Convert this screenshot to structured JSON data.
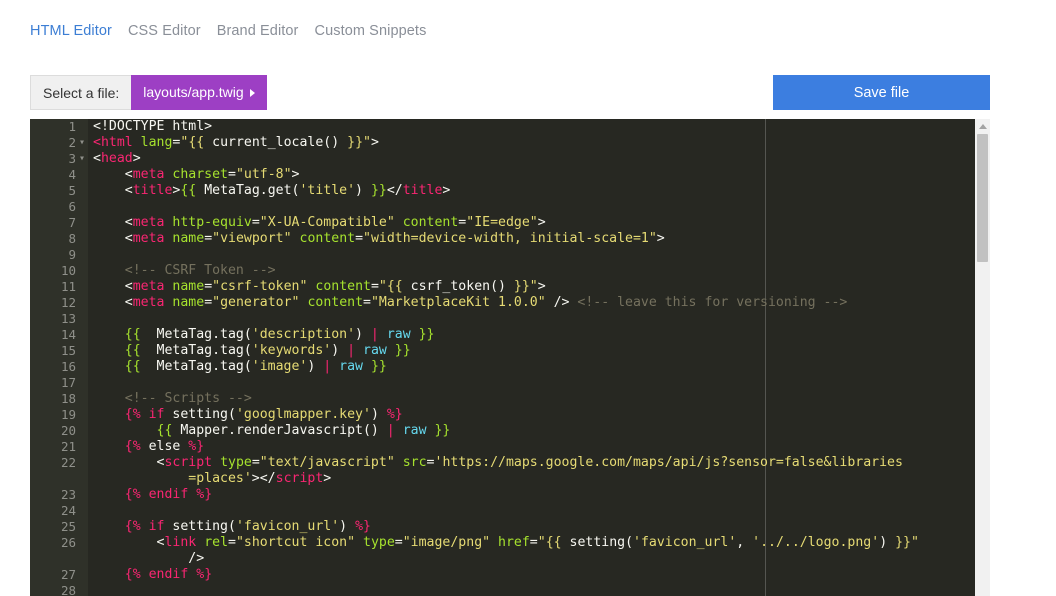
{
  "tabs": [
    {
      "label": "HTML Editor",
      "active": true
    },
    {
      "label": "CSS Editor",
      "active": false
    },
    {
      "label": "Brand Editor",
      "active": false
    },
    {
      "label": "Custom Snippets",
      "active": false
    }
  ],
  "file_selector": {
    "label": "Select a file:",
    "value": "layouts/app.twig"
  },
  "save_button": {
    "label": "Save file"
  },
  "editor": {
    "lines": [
      {
        "n": "1",
        "fold": false,
        "tokens": [
          [
            "",
            "<!DOCTYPE html>"
          ]
        ]
      },
      {
        "n": "2",
        "fold": true,
        "tokens": [
          [
            "tag",
            "<html"
          ],
          [
            "",
            " "
          ],
          [
            "attr",
            "lang"
          ],
          [
            "",
            "="
          ],
          [
            "str",
            "\"{{ "
          ],
          [
            "",
            "current_locale() "
          ],
          [
            "str",
            "}}\""
          ],
          [
            "",
            ">"
          ]
        ]
      },
      {
        "n": "3",
        "fold": true,
        "tokens": [
          [
            "",
            "<"
          ],
          [
            "tag",
            "head"
          ],
          [
            "",
            ">"
          ]
        ]
      },
      {
        "n": "4",
        "fold": false,
        "tokens": [
          [
            "",
            "    <"
          ],
          [
            "tag",
            "meta"
          ],
          [
            "",
            " "
          ],
          [
            "attr",
            "charset"
          ],
          [
            "",
            "="
          ],
          [
            "str",
            "\"utf-8\""
          ],
          [
            "",
            ">"
          ]
        ]
      },
      {
        "n": "5",
        "fold": false,
        "tokens": [
          [
            "",
            "    <"
          ],
          [
            "tag",
            "title"
          ],
          [
            "",
            ">"
          ],
          [
            "twig",
            "{{"
          ],
          [
            "",
            " MetaTag.get("
          ],
          [
            "str",
            "'title'"
          ],
          [
            "",
            ") "
          ],
          [
            "twig",
            "}}"
          ],
          [
            "",
            "</"
          ],
          [
            "tag",
            "title"
          ],
          [
            "",
            ">"
          ]
        ]
      },
      {
        "n": "6",
        "fold": false,
        "tokens": [
          [
            "",
            ""
          ]
        ]
      },
      {
        "n": "7",
        "fold": false,
        "tokens": [
          [
            "",
            "    <"
          ],
          [
            "tag",
            "meta"
          ],
          [
            "",
            " "
          ],
          [
            "attr",
            "http-equiv"
          ],
          [
            "",
            "="
          ],
          [
            "str",
            "\"X-UA-Compatible\""
          ],
          [
            "",
            " "
          ],
          [
            "attr",
            "content"
          ],
          [
            "",
            "="
          ],
          [
            "str",
            "\"IE=edge\""
          ],
          [
            "",
            ">"
          ]
        ]
      },
      {
        "n": "8",
        "fold": false,
        "tokens": [
          [
            "",
            "    <"
          ],
          [
            "tag",
            "meta"
          ],
          [
            "",
            " "
          ],
          [
            "attr",
            "name"
          ],
          [
            "",
            "="
          ],
          [
            "str",
            "\"viewport\""
          ],
          [
            "",
            " "
          ],
          [
            "attr",
            "content"
          ],
          [
            "",
            "="
          ],
          [
            "str",
            "\"width=device-width, initial-scale=1\""
          ],
          [
            "",
            ">"
          ]
        ]
      },
      {
        "n": "9",
        "fold": false,
        "tokens": [
          [
            "",
            ""
          ]
        ]
      },
      {
        "n": "10",
        "fold": false,
        "tokens": [
          [
            "cmt",
            "    <!-- CSRF Token -->"
          ]
        ]
      },
      {
        "n": "11",
        "fold": false,
        "tokens": [
          [
            "",
            "    <"
          ],
          [
            "tag",
            "meta"
          ],
          [
            "",
            " "
          ],
          [
            "attr",
            "name"
          ],
          [
            "",
            "="
          ],
          [
            "str",
            "\"csrf-token\""
          ],
          [
            "",
            " "
          ],
          [
            "attr",
            "content"
          ],
          [
            "",
            "="
          ],
          [
            "str",
            "\"{{ "
          ],
          [
            "",
            "csrf_token() "
          ],
          [
            "str",
            "}}\""
          ],
          [
            "",
            ">"
          ]
        ]
      },
      {
        "n": "12",
        "fold": false,
        "tokens": [
          [
            "",
            "    <"
          ],
          [
            "tag",
            "meta"
          ],
          [
            "",
            " "
          ],
          [
            "attr",
            "name"
          ],
          [
            "",
            "="
          ],
          [
            "str",
            "\"generator\""
          ],
          [
            "",
            " "
          ],
          [
            "attr",
            "content"
          ],
          [
            "",
            "="
          ],
          [
            "str",
            "\"MarketplaceKit 1.0.0\""
          ],
          [
            "",
            " /> "
          ],
          [
            "cmt",
            "<!-- leave this for versioning -->"
          ]
        ]
      },
      {
        "n": "13",
        "fold": false,
        "tokens": [
          [
            "",
            ""
          ]
        ]
      },
      {
        "n": "14",
        "fold": false,
        "tokens": [
          [
            "twig",
            "    {{"
          ],
          [
            "",
            "  MetaTag.tag("
          ],
          [
            "str",
            "'description'"
          ],
          [
            "",
            ") "
          ],
          [
            "pipe",
            "|"
          ],
          [
            "",
            " "
          ],
          [
            "filter",
            "raw"
          ],
          [
            "",
            " "
          ],
          [
            "twig",
            "}}"
          ]
        ]
      },
      {
        "n": "15",
        "fold": false,
        "tokens": [
          [
            "twig",
            "    {{"
          ],
          [
            "",
            "  MetaTag.tag("
          ],
          [
            "str",
            "'keywords'"
          ],
          [
            "",
            ") "
          ],
          [
            "pipe",
            "|"
          ],
          [
            "",
            " "
          ],
          [
            "filter",
            "raw"
          ],
          [
            "",
            " "
          ],
          [
            "twig",
            "}}"
          ]
        ]
      },
      {
        "n": "16",
        "fold": false,
        "tokens": [
          [
            "twig",
            "    {{"
          ],
          [
            "",
            "  MetaTag.tag("
          ],
          [
            "str",
            "'image'"
          ],
          [
            "",
            ") "
          ],
          [
            "pipe",
            "|"
          ],
          [
            "",
            " "
          ],
          [
            "filter",
            "raw"
          ],
          [
            "",
            " "
          ],
          [
            "twig",
            "}}"
          ]
        ]
      },
      {
        "n": "17",
        "fold": false,
        "tokens": [
          [
            "",
            ""
          ]
        ]
      },
      {
        "n": "18",
        "fold": false,
        "tokens": [
          [
            "cmt",
            "    <!-- Scripts -->"
          ]
        ]
      },
      {
        "n": "19",
        "fold": false,
        "tokens": [
          [
            "ctrl",
            "    {%"
          ],
          [
            "",
            " "
          ],
          [
            "ctrl",
            "if"
          ],
          [
            "",
            " setting("
          ],
          [
            "str",
            "'googlmapper.key'"
          ],
          [
            "",
            ") "
          ],
          [
            "ctrl",
            "%}"
          ]
        ]
      },
      {
        "n": "20",
        "fold": false,
        "tokens": [
          [
            "",
            "        "
          ],
          [
            "twig",
            "{{"
          ],
          [
            "",
            " Mapper.renderJavascript() "
          ],
          [
            "pipe",
            "|"
          ],
          [
            "",
            " "
          ],
          [
            "filter",
            "raw"
          ],
          [
            "",
            " "
          ],
          [
            "twig",
            "}}"
          ]
        ]
      },
      {
        "n": "21",
        "fold": false,
        "tokens": [
          [
            "ctrl",
            "    {%"
          ],
          [
            "",
            " else "
          ],
          [
            "ctrl",
            "%}"
          ]
        ]
      },
      {
        "n": "22",
        "fold": false,
        "tokens": [
          [
            "",
            "        <"
          ],
          [
            "tag",
            "script"
          ],
          [
            "",
            " "
          ],
          [
            "attr",
            "type"
          ],
          [
            "",
            "="
          ],
          [
            "str",
            "\"text/javascript\""
          ],
          [
            "",
            " "
          ],
          [
            "attr",
            "src"
          ],
          [
            "",
            "="
          ],
          [
            "str",
            "'https://maps.google.com/maps/api/js?sensor=false&libraries"
          ]
        ]
      },
      {
        "n": "",
        "fold": false,
        "tokens": [
          [
            "str",
            "            =places'"
          ],
          [
            "",
            "></"
          ],
          [
            "tag",
            "script"
          ],
          [
            "",
            ">"
          ]
        ]
      },
      {
        "n": "23",
        "fold": false,
        "tokens": [
          [
            "ctrl",
            "    {%"
          ],
          [
            "",
            " "
          ],
          [
            "ctrl",
            "endif"
          ],
          [
            "",
            " "
          ],
          [
            "ctrl",
            "%}"
          ]
        ]
      },
      {
        "n": "24",
        "fold": false,
        "tokens": [
          [
            "",
            ""
          ]
        ]
      },
      {
        "n": "25",
        "fold": false,
        "tokens": [
          [
            "ctrl",
            "    {%"
          ],
          [
            "",
            " "
          ],
          [
            "ctrl",
            "if"
          ],
          [
            "",
            " setting("
          ],
          [
            "str",
            "'favicon_url'"
          ],
          [
            "",
            ") "
          ],
          [
            "ctrl",
            "%}"
          ]
        ]
      },
      {
        "n": "26",
        "fold": false,
        "tokens": [
          [
            "",
            "        <"
          ],
          [
            "tag",
            "link"
          ],
          [
            "",
            " "
          ],
          [
            "attr",
            "rel"
          ],
          [
            "",
            "="
          ],
          [
            "str",
            "\"shortcut icon\""
          ],
          [
            "",
            " "
          ],
          [
            "attr",
            "type"
          ],
          [
            "",
            "="
          ],
          [
            "str",
            "\"image/png\""
          ],
          [
            "",
            " "
          ],
          [
            "attr",
            "href"
          ],
          [
            "",
            "="
          ],
          [
            "str",
            "\"{{ "
          ],
          [
            "",
            "setting("
          ],
          [
            "str",
            "'favicon_url'"
          ],
          [
            "",
            ", "
          ],
          [
            "str",
            "'../../logo.png'"
          ],
          [
            "",
            ") "
          ],
          [
            "str",
            "}}\""
          ]
        ]
      },
      {
        "n": "",
        "fold": false,
        "tokens": [
          [
            "",
            "            />"
          ]
        ]
      },
      {
        "n": "27",
        "fold": false,
        "tokens": [
          [
            "ctrl",
            "    {%"
          ],
          [
            "",
            " "
          ],
          [
            "ctrl",
            "endif"
          ],
          [
            "",
            " "
          ],
          [
            "ctrl",
            "%}"
          ]
        ]
      },
      {
        "n": "28",
        "fold": false,
        "tokens": [
          [
            "",
            ""
          ]
        ]
      }
    ]
  }
}
